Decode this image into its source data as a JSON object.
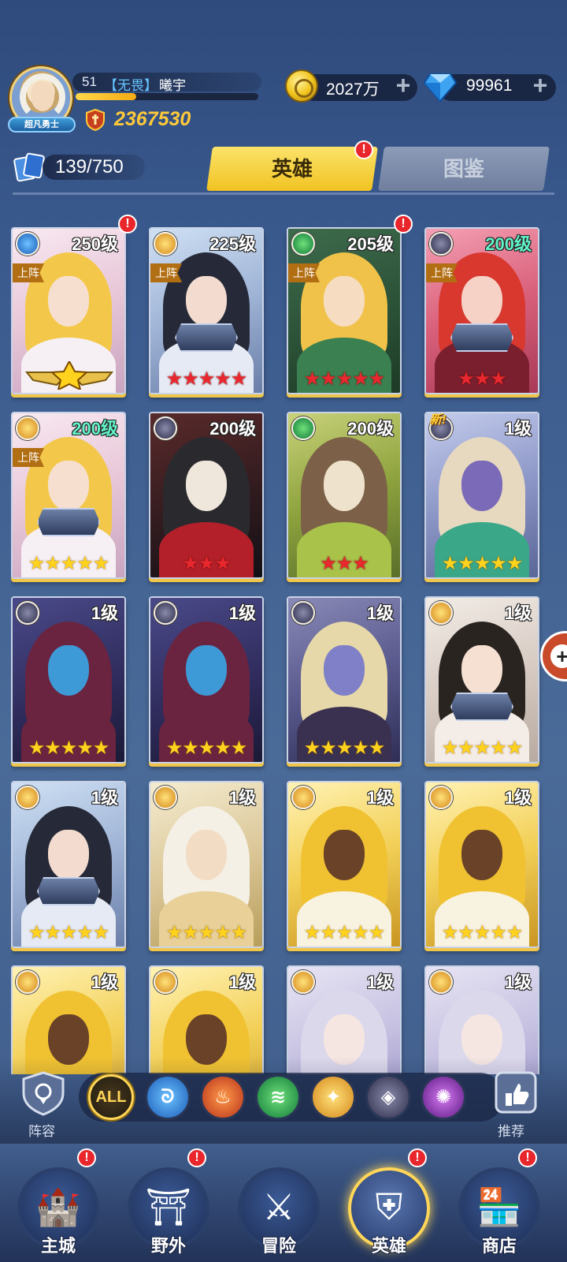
{
  "player": {
    "level": "51",
    "guild": "【无畏】",
    "name": "曦宇",
    "rank_title": "超凡勇士",
    "power": "2367530",
    "exp_fraction": 0.33
  },
  "resources": {
    "coins": "2027万",
    "diamonds": "99961"
  },
  "hero_count": "139/750",
  "tabs": {
    "heroes": "英雄",
    "codex": "图鉴"
  },
  "cards": [
    {
      "level": "250级",
      "deploy": "上阵",
      "element": "water",
      "stars": 0,
      "star_color": "gold",
      "wings": true,
      "notify": "!",
      "lvl_color": "white",
      "art": "blonde"
    },
    {
      "level": "225级",
      "deploy": "上阵",
      "element": "light",
      "stars": 5,
      "star_color": "red",
      "notify": "",
      "lvl_color": "white",
      "art": "dark"
    },
    {
      "level": "205级",
      "deploy": "上阵",
      "element": "wind",
      "stars": 5,
      "star_color": "red",
      "notify": "!",
      "lvl_color": "white",
      "art": "green"
    },
    {
      "level": "200级",
      "deploy": "上阵",
      "element": "dark",
      "stars": 3,
      "star_color": "red",
      "notify": "",
      "lvl_color": "cyan",
      "art": "red"
    },
    {
      "level": "200级",
      "deploy": "上阵",
      "element": "light",
      "stars": 5,
      "star_color": "gold",
      "notify": "",
      "lvl_color": "cyan",
      "art": "blonde"
    },
    {
      "level": "200级",
      "deploy": "",
      "element": "dark",
      "stars": 3,
      "star_color": "red",
      "notify": "",
      "lvl_color": "white",
      "art": "skull"
    },
    {
      "level": "200级",
      "deploy": "",
      "element": "wind",
      "stars": 3,
      "star_color": "red",
      "notify": "",
      "lvl_color": "white",
      "art": "beast"
    },
    {
      "level": "1级",
      "deploy": "",
      "element": "dark",
      "stars": 5,
      "star_color": "gold",
      "notify": "",
      "lvl_color": "white",
      "art": "robot",
      "new_tag": "新!"
    },
    {
      "level": "1级",
      "deploy": "",
      "element": "dark",
      "stars": 5,
      "star_color": "gold",
      "notify": "",
      "lvl_color": "white",
      "art": "plague"
    },
    {
      "level": "1级",
      "deploy": "",
      "element": "dark",
      "stars": 5,
      "star_color": "gold",
      "notify": "",
      "lvl_color": "white",
      "art": "plague"
    },
    {
      "level": "1级",
      "deploy": "",
      "element": "dark",
      "stars": 5,
      "star_color": "gold",
      "notify": "",
      "lvl_color": "white",
      "art": "vampire"
    },
    {
      "level": "1级",
      "deploy": "",
      "element": "light",
      "stars": 5,
      "star_color": "gold",
      "notify": "",
      "lvl_color": "white",
      "art": "princess"
    },
    {
      "level": "1级",
      "deploy": "",
      "element": "light",
      "stars": 5,
      "star_color": "gold",
      "notify": "",
      "lvl_color": "white",
      "art": "dark"
    },
    {
      "level": "1级",
      "deploy": "",
      "element": "light",
      "stars": 5,
      "star_color": "gold",
      "notify": "",
      "lvl_color": "white",
      "art": "elf"
    },
    {
      "level": "1级",
      "deploy": "",
      "element": "light",
      "stars": 5,
      "star_color": "gold",
      "notify": "",
      "lvl_color": "white",
      "art": "goddess"
    },
    {
      "level": "1级",
      "deploy": "",
      "element": "light",
      "stars": 5,
      "star_color": "gold",
      "notify": "",
      "lvl_color": "white",
      "art": "goddess"
    },
    {
      "level": "1级",
      "deploy": "",
      "element": "light",
      "stars": 0,
      "star_color": "gold",
      "notify": "",
      "lvl_color": "white",
      "art": "goddess"
    },
    {
      "level": "1级",
      "deploy": "",
      "element": "light",
      "stars": 0,
      "star_color": "gold",
      "notify": "",
      "lvl_color": "white",
      "art": "goddess"
    },
    {
      "level": "1级",
      "deploy": "",
      "element": "light",
      "stars": 0,
      "star_color": "gold",
      "notify": "",
      "lvl_color": "white",
      "art": "silver"
    },
    {
      "level": "1级",
      "deploy": "",
      "element": "light",
      "stars": 0,
      "star_color": "gold",
      "notify": "",
      "lvl_color": "white",
      "art": "silver"
    }
  ],
  "filters": {
    "lineup_label": "阵容",
    "recommend_label": "推荐",
    "all_label": "ALL",
    "items": [
      {
        "name": "water",
        "color": "#2f7fd6"
      },
      {
        "name": "fire",
        "color": "#d9541e"
      },
      {
        "name": "wind",
        "color": "#1fa84a"
      },
      {
        "name": "light",
        "color": "#f0a524"
      },
      {
        "name": "dark",
        "color": "#4a4a6e"
      },
      {
        "name": "chaos",
        "color": "#8a34b8"
      }
    ]
  },
  "nav": [
    {
      "label": "主城",
      "icon": "castle-icon",
      "notify": "!"
    },
    {
      "label": "野外",
      "icon": "portal-icon",
      "notify": "!"
    },
    {
      "label": "冒险",
      "icon": "sword-icon",
      "notify": ""
    },
    {
      "label": "英雄",
      "icon": "helmet-icon",
      "notify": "!",
      "active": true
    },
    {
      "label": "商店",
      "icon": "shop-icon",
      "notify": "!"
    }
  ],
  "colors": {
    "accent_gold": "#f1c322",
    "notify_red": "#e8262b"
  }
}
